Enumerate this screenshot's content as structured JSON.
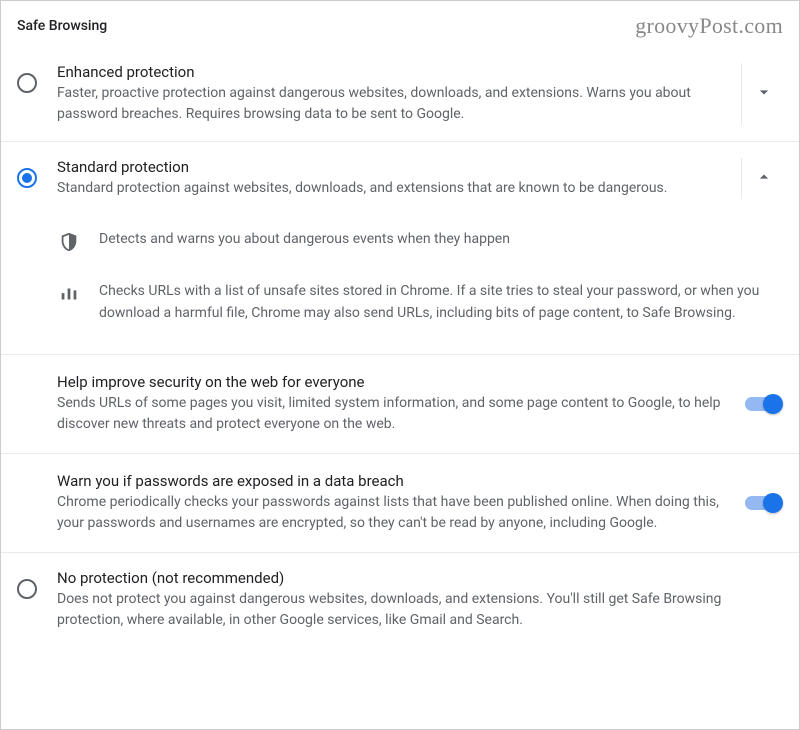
{
  "header": {
    "title": "Safe Browsing",
    "watermark": "groovyPost.com"
  },
  "options": {
    "enhanced": {
      "title": "Enhanced protection",
      "desc": "Faster, proactive protection against dangerous websites, downloads, and extensions. Warns you about password breaches. Requires browsing data to be sent to Google."
    },
    "standard": {
      "title": "Standard protection",
      "desc": "Standard protection against websites, downloads, and extensions that are known to be dangerous.",
      "features": {
        "f1": "Detects and warns you about dangerous events when they happen",
        "f2": "Checks URLs with a list of unsafe sites stored in Chrome. If a site tries to steal your password, or when you download a harmful file, Chrome may also send URLs, including bits of page content, to Safe Browsing."
      },
      "toggles": {
        "improve": {
          "title": "Help improve security on the web for everyone",
          "desc": "Sends URLs of some pages you visit, limited system information, and some page content to Google, to help discover new threats and protect everyone on the web."
        },
        "breach": {
          "title": "Warn you if passwords are exposed in a data breach",
          "desc": "Chrome periodically checks your passwords against lists that have been published online. When doing this, your passwords and usernames are encrypted, so they can't be read by anyone, including Google."
        }
      }
    },
    "none": {
      "title": "No protection (not recommended)",
      "desc": "Does not protect you against dangerous websites, downloads, and extensions. You'll still get Safe Browsing protection, where available, in other Google services, like Gmail and Search."
    }
  }
}
